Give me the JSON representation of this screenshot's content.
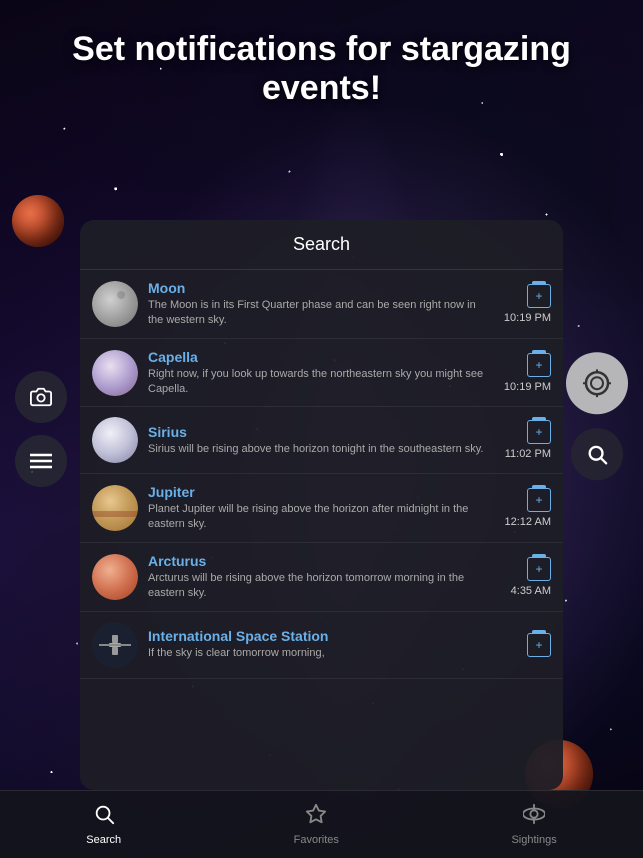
{
  "header": {
    "title": "Set notifications for stargazing events!"
  },
  "search_panel": {
    "title": "Search"
  },
  "items": [
    {
      "id": "moon",
      "name": "Moon",
      "description": "The Moon is in its First Quarter phase and can be seen right now in the western sky.",
      "time": "10:19 PM"
    },
    {
      "id": "capella",
      "name": "Capella",
      "description": "Right now, if you look up towards the northeastern sky you might see Capella.",
      "time": "10:19 PM"
    },
    {
      "id": "sirius",
      "name": "Sirius",
      "description": "Sirius will be rising above the horizon tonight in the southeastern sky.",
      "time": "11:02 PM"
    },
    {
      "id": "jupiter",
      "name": "Jupiter",
      "description": "Planet Jupiter will be rising above the horizon after midnight in the eastern sky.",
      "time": "12:12 AM"
    },
    {
      "id": "arcturus",
      "name": "Arcturus",
      "description": "Arcturus will be rising above the horizon tomorrow morning in the eastern sky.",
      "time": "4:35 AM"
    },
    {
      "id": "iss",
      "name": "International Space Station",
      "description": "If the sky is clear tomorrow morning,",
      "time": ""
    }
  ],
  "tabs": [
    {
      "id": "search",
      "label": "Search",
      "active": true
    },
    {
      "id": "favorites",
      "label": "Favorites",
      "active": false
    },
    {
      "id": "sightings",
      "label": "Sightings",
      "active": false
    }
  ],
  "sidebar": {
    "camera_label": "Camera",
    "menu_label": "Menu"
  },
  "right_buttons": {
    "scope_label": "Scope",
    "search_label": "Search"
  }
}
